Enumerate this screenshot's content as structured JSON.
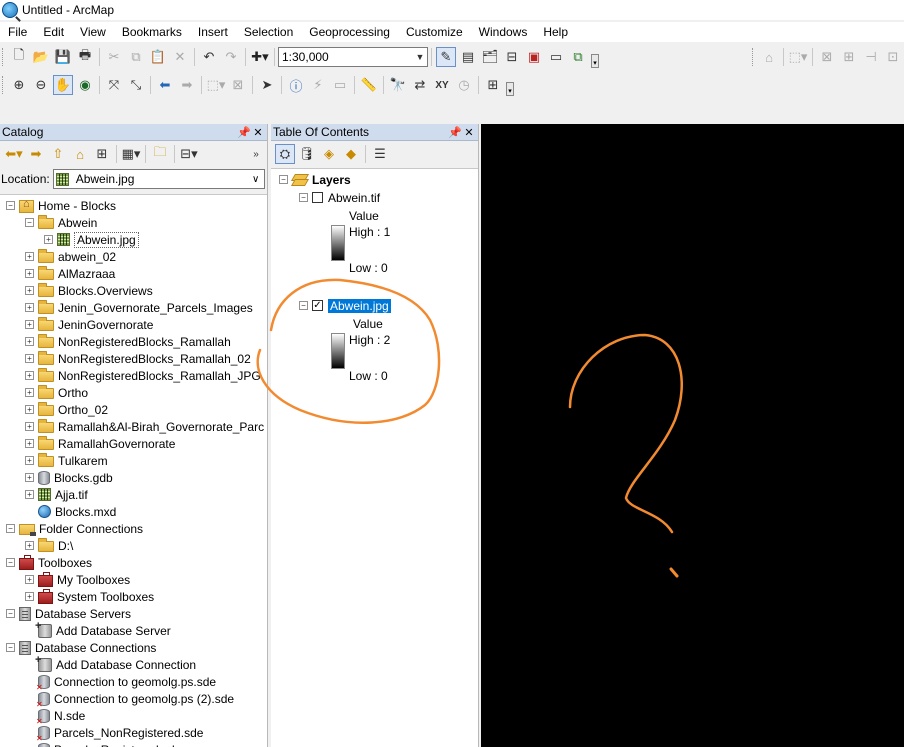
{
  "window": {
    "title": "Untitled - ArcMap"
  },
  "menu": [
    "File",
    "Edit",
    "View",
    "Bookmarks",
    "Insert",
    "Selection",
    "Geoprocessing",
    "Customize",
    "Windows",
    "Help"
  ],
  "toolbar": {
    "scale_value": "1:30,000"
  },
  "catalog": {
    "title": "Catalog",
    "location_label": "Location:",
    "location_value": "Abwein.jpg",
    "tree": [
      {
        "label": "Home - Blocks",
        "indent": 0,
        "exp": "−",
        "icon": "home-folder-icon"
      },
      {
        "label": "Abwein",
        "indent": 1,
        "exp": "−",
        "icon": "folder-icon"
      },
      {
        "label": "Abwein.jpg",
        "indent": 2,
        "exp": "+",
        "icon": "raster-icon",
        "selected": true
      },
      {
        "label": "abwein_02",
        "indent": 1,
        "exp": "+",
        "icon": "folder-icon"
      },
      {
        "label": "AlMazraaa",
        "indent": 1,
        "exp": "+",
        "icon": "folder-icon"
      },
      {
        "label": "Blocks.Overviews",
        "indent": 1,
        "exp": "+",
        "icon": "folder-icon"
      },
      {
        "label": "Jenin_Governorate_Parcels_Images",
        "indent": 1,
        "exp": "+",
        "icon": "folder-icon"
      },
      {
        "label": "JeninGovernorate",
        "indent": 1,
        "exp": "+",
        "icon": "folder-icon"
      },
      {
        "label": "NonRegisteredBlocks_Ramallah",
        "indent": 1,
        "exp": "+",
        "icon": "folder-icon"
      },
      {
        "label": "NonRegisteredBlocks_Ramallah_02",
        "indent": 1,
        "exp": "+",
        "icon": "folder-icon"
      },
      {
        "label": "NonRegisteredBlocks_Ramallah_JPG",
        "indent": 1,
        "exp": "+",
        "icon": "folder-icon"
      },
      {
        "label": "Ortho",
        "indent": 1,
        "exp": "+",
        "icon": "folder-icon"
      },
      {
        "label": "Ortho_02",
        "indent": 1,
        "exp": "+",
        "icon": "folder-icon"
      },
      {
        "label": "Ramallah&Al-Birah_Governorate_Parc",
        "indent": 1,
        "exp": "+",
        "icon": "folder-icon"
      },
      {
        "label": "RamallahGovernorate",
        "indent": 1,
        "exp": "+",
        "icon": "folder-icon"
      },
      {
        "label": "Tulkarem",
        "indent": 1,
        "exp": "+",
        "icon": "folder-icon"
      },
      {
        "label": "Blocks.gdb",
        "indent": 1,
        "exp": "+",
        "icon": "geodatabase-icon"
      },
      {
        "label": "Ajja.tif",
        "indent": 1,
        "exp": "+",
        "icon": "raster-icon"
      },
      {
        "label": "Blocks.mxd",
        "indent": 1,
        "exp": "",
        "icon": "map-document-icon"
      },
      {
        "label": "Folder Connections",
        "indent": 0,
        "exp": "−",
        "icon": "folder-connections-icon"
      },
      {
        "label": "D:\\",
        "indent": 1,
        "exp": "+",
        "icon": "folder-icon"
      },
      {
        "label": "Toolboxes",
        "indent": 0,
        "exp": "−",
        "icon": "toolboxes-icon"
      },
      {
        "label": "My Toolboxes",
        "indent": 1,
        "exp": "+",
        "icon": "toolbox-icon"
      },
      {
        "label": "System Toolboxes",
        "indent": 1,
        "exp": "+",
        "icon": "toolbox-icon"
      },
      {
        "label": "Database Servers",
        "indent": 0,
        "exp": "−",
        "icon": "database-servers-icon"
      },
      {
        "label": "Add Database Server",
        "indent": 1,
        "exp": "",
        "icon": "add-server-icon"
      },
      {
        "label": "Database Connections",
        "indent": 0,
        "exp": "−",
        "icon": "database-connections-icon"
      },
      {
        "label": "Add Database Connection",
        "indent": 1,
        "exp": "",
        "icon": "add-connection-icon"
      },
      {
        "label": "Connection to geomolg.ps.sde",
        "indent": 1,
        "exp": "",
        "icon": "sde-connection-icon"
      },
      {
        "label": "Connection to geomolg.ps (2).sde",
        "indent": 1,
        "exp": "",
        "icon": "sde-connection-icon"
      },
      {
        "label": "N.sde",
        "indent": 1,
        "exp": "",
        "icon": "sde-connection-icon"
      },
      {
        "label": "Parcels_NonRegistered.sde",
        "indent": 1,
        "exp": "",
        "icon": "sde-connection-icon"
      },
      {
        "label": "Parcels_Registered.sde",
        "indent": 1,
        "exp": "",
        "icon": "sde-connection-icon"
      }
    ]
  },
  "toc": {
    "title": "Table Of Contents",
    "layers_label": "Layers",
    "layers": [
      {
        "name": "Abwein.tif",
        "checked": false,
        "selected": false,
        "value_label": "Value",
        "high": "High : 1",
        "low": "Low : 0"
      },
      {
        "name": "Abwein.jpg",
        "checked": true,
        "selected": true,
        "value_label": "Value",
        "high": "High : 2",
        "low": "Low : 0"
      }
    ]
  },
  "colors": {
    "annotation": "#f28a30",
    "selection": "#0078d7",
    "map_background": "#000000",
    "panel_header": "#cfdcee"
  }
}
